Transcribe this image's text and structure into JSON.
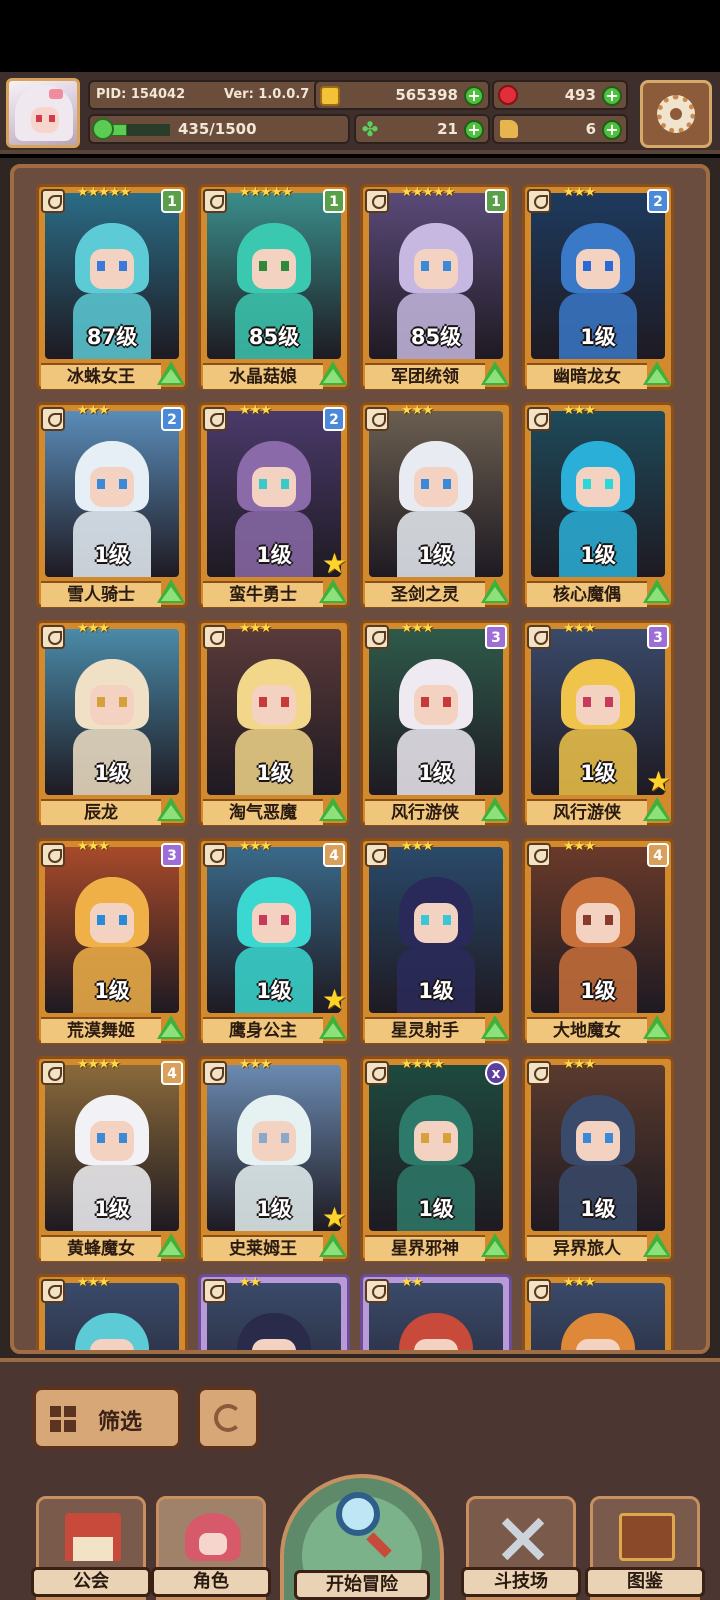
{
  "player": {
    "pid": "PID: 154042",
    "version": "Ver: 1.0.0.7",
    "gold": "565398",
    "gems": "493",
    "energy": "435/1500",
    "energy_ratio": 0.29,
    "clover": "21",
    "boots": "6"
  },
  "heroes": [
    {
      "name": "冰蛛女王",
      "level": "87级",
      "rank": "1",
      "stars": "★★★★★",
      "palette": "#5ccbd6",
      "skin_bg": "#2a6c86",
      "eye": "#3a7ad8"
    },
    {
      "name": "水晶菇娘",
      "level": "85级",
      "rank": "1",
      "stars": "★★★★★",
      "palette": "#3bc8b0",
      "skin_bg": "#3a8d8a",
      "eye": "#2e8a3a"
    },
    {
      "name": "军团统领",
      "level": "85级",
      "rank": "1",
      "stars": "★★★★★",
      "palette": "#c6b8e0",
      "skin_bg": "#5a4a78",
      "eye": "#3a8ad8"
    },
    {
      "name": "幽暗龙女",
      "level": "1级",
      "rank": "2",
      "stars": "★★★",
      "palette": "#3a78c8",
      "skin_bg": "#1e3a5e",
      "eye": "#2a6ad8"
    },
    {
      "name": "雪人骑士",
      "level": "1级",
      "rank": "2",
      "stars": "★★★",
      "palette": "#e6eef6",
      "skin_bg": "#5a8cb8",
      "eye": "#3a8ad8"
    },
    {
      "name": "蛮牛勇士",
      "level": "1级",
      "rank": "2",
      "stars": "★★★",
      "palette": "#8a6aa8",
      "skin_bg": "#4a3a6a",
      "eye": "#3ac8c8"
    },
    {
      "name": "圣剑之灵",
      "level": "1级",
      "rank": "",
      "stars": "★★★",
      "palette": "#e8ecf2",
      "skin_bg": "#6a5e50",
      "eye": "#3a8ad8"
    },
    {
      "name": "核心魔偶",
      "level": "1级",
      "rank": "",
      "stars": "★★★",
      "palette": "#2ab0d8",
      "skin_bg": "#1e4a5a",
      "eye": "#2ad8d8"
    },
    {
      "name": "辰龙",
      "level": "1级",
      "rank": "",
      "stars": "★★★",
      "palette": "#efe0c6",
      "skin_bg": "#4a8aa8",
      "eye": "#d8a03a"
    },
    {
      "name": "淘气恶魔",
      "level": "1级",
      "rank": "",
      "stars": "★★★",
      "palette": "#f2d68a",
      "skin_bg": "#5a3a3a",
      "eye": "#c83a3a"
    },
    {
      "name": "风行游侠",
      "level": "1级",
      "rank": "3",
      "stars": "★★★",
      "palette": "#efeaf2",
      "skin_bg": "#2e5a4a",
      "eye": "#c83a3a"
    },
    {
      "name": "风行游侠",
      "level": "1级",
      "rank": "3",
      "stars": "★★★",
      "palette": "#f0c44a",
      "skin_bg": "#3a4a6a",
      "eye": "#c83a5a"
    },
    {
      "name": "荒漠舞姬",
      "level": "1级",
      "rank": "3",
      "stars": "★★★",
      "palette": "#f0b048",
      "skin_bg": "#a84a2a",
      "eye": "#2a8ad8"
    },
    {
      "name": "鹰身公主",
      "level": "1级",
      "rank": "4",
      "stars": "★★★",
      "palette": "#3ad8d0",
      "skin_bg": "#3a6a8a",
      "eye": "#c83a5a"
    },
    {
      "name": "星灵射手",
      "level": "1级",
      "rank": "",
      "stars": "★★★",
      "palette": "#2a2a5a",
      "skin_bg": "#2a4a6a",
      "eye": "#3ac8d8"
    },
    {
      "name": "大地魔女",
      "level": "1级",
      "rank": "4",
      "stars": "★★★",
      "palette": "#c8703a",
      "skin_bg": "#6a3a2a",
      "eye": "#8a3a2a"
    },
    {
      "name": "黄蜂魔女",
      "level": "1级",
      "rank": "4",
      "stars": "★★★★",
      "palette": "#f2f2f6",
      "skin_bg": "#8a6a3a",
      "eye": "#3a8ad8"
    },
    {
      "name": "史莱姆王",
      "level": "1级",
      "rank": "",
      "stars": "★★★",
      "palette": "#e6f2f2",
      "skin_bg": "#6a8ab0",
      "eye": "#8aa8c8"
    },
    {
      "name": "星界邪神",
      "level": "1级",
      "rank": "x",
      "stars": "★★★★",
      "palette": "#2e7a6a",
      "skin_bg": "#1e4a3e",
      "eye": "#d8a03a"
    },
    {
      "name": "异界旅人",
      "level": "1级",
      "rank": "",
      "stars": "★★★",
      "palette": "#3a4a6a",
      "skin_bg": "#5a3a2e",
      "eye": "#3a8ad8"
    }
  ],
  "partial_heroes": [
    {
      "stars": "★★★",
      "palette": "#5ccbd6",
      "frame": "orange"
    },
    {
      "stars": "★★",
      "palette": "#2a2a4a",
      "frame": "purple"
    },
    {
      "stars": "★★",
      "palette": "#c84a3a",
      "frame": "purple"
    },
    {
      "stars": "★★★",
      "palette": "#e0883a",
      "frame": "orange"
    }
  ],
  "controls": {
    "filter_label": "筛选"
  },
  "nav": {
    "guild": "公会",
    "role": "角色",
    "adventure": "开始冒险",
    "arena": "斗技场",
    "codex": "图鉴"
  }
}
